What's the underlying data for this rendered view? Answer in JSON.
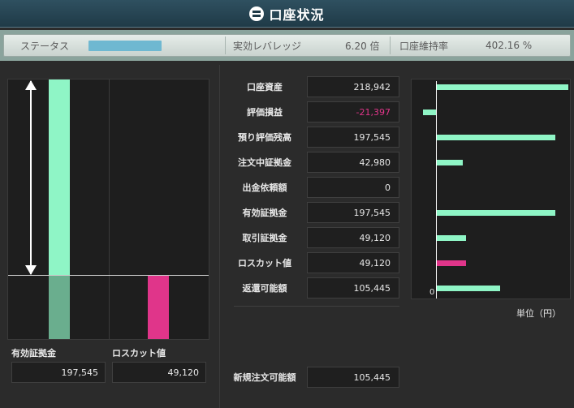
{
  "header": {
    "title": "口座状況",
    "icon": "account-icon"
  },
  "status": {
    "label": "ステータス",
    "level": 0.45,
    "leverage_label": "実効レバレッジ",
    "leverage_value": "6.20 倍",
    "maintenance_label": "口座維持率",
    "maintenance_value": "402.16 %",
    "fill_color": "#6fb8d1"
  },
  "left_chart": {
    "margin_label": "有効証拠金",
    "margin_value": "197,545",
    "losscut_label": "ロスカット値",
    "losscut_value": "49,120",
    "colors": {
      "margin": "#8ff5c6",
      "margin_below": "#6aae8e",
      "losscut": "#e0358a"
    }
  },
  "table": {
    "rows": [
      {
        "label": "口座資産",
        "value": "218,942"
      },
      {
        "label": "評価損益",
        "value": "-21,397",
        "negative": true
      },
      {
        "label": "預り評価残高",
        "value": "197,545"
      },
      {
        "label": "注文中証拠金",
        "value": "42,980"
      },
      {
        "label": "出金依頼額",
        "value": "0"
      },
      {
        "label": "有効証拠金",
        "value": "197,545"
      },
      {
        "label": "取引証拠金",
        "value": "49,120"
      },
      {
        "label": "ロスカット値",
        "value": "49,120"
      },
      {
        "label": "返還可能額",
        "value": "105,445"
      }
    ],
    "new_order_label": "新規注文可能額",
    "new_order_value": "105,445",
    "negative_color": "#e0358a"
  },
  "right_chart": {
    "zero_label": "0",
    "unit_label": "単位（円）",
    "values": [
      218942,
      -21397,
      197545,
      42980,
      0,
      197545,
      49120,
      49120,
      105445
    ],
    "colors": {
      "default": "#8ff5c6",
      "losscut": "#e0358a"
    }
  }
}
